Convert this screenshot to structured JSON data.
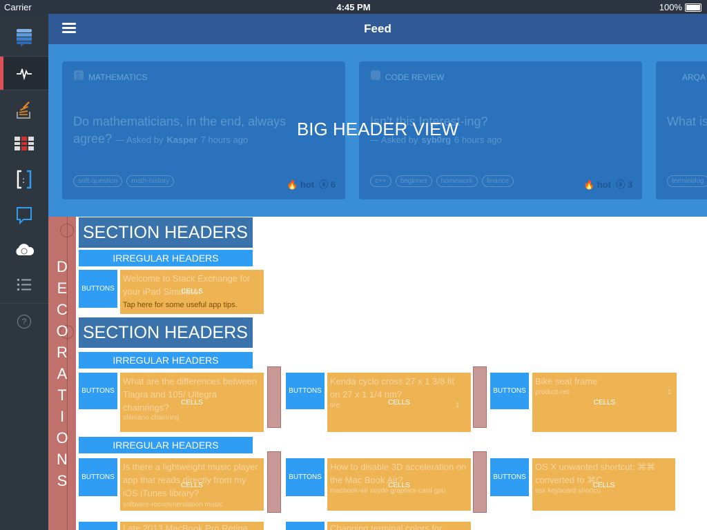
{
  "status_bar": {
    "carrier": "Carrier",
    "time": "4:45 PM",
    "battery": "100%"
  },
  "nav": {
    "title": "Feed"
  },
  "sidebar": {
    "items": [
      {
        "icon": "stack-exchange-logo-icon"
      },
      {
        "icon": "activity-pulse-icon",
        "active": true
      },
      {
        "icon": "stack-overflow-icon"
      },
      {
        "icon": "server-fault-icon"
      },
      {
        "icon": "code-review-icon"
      },
      {
        "icon": "chat-bubble-icon"
      },
      {
        "icon": "cloud-icon"
      },
      {
        "icon": "list-icon"
      },
      {
        "icon": "help-icon",
        "label": "?"
      }
    ]
  },
  "big_header": {
    "label": "BIG HEADER VIEW",
    "cards": [
      {
        "site": "MATHEMATICS",
        "question": "Do mathematicians, in the end, always agree?",
        "asked_prefix": "— Asked by",
        "user": "Kasper",
        "when": "7 hours ago",
        "tags": [
          "soft-question",
          "math-history"
        ],
        "badge": "hot",
        "count": "6"
      },
      {
        "site": "CODE REVIEW",
        "question": "Isn't this Interest-ing?",
        "asked_prefix": "— Asked by",
        "user": "syb0rg",
        "when": "6 hours ago",
        "tags": [
          "c++",
          "beginner",
          "homework",
          "finance"
        ],
        "badge": "hot",
        "count": "3"
      },
      {
        "site": "ARQA",
        "question": "What is",
        "tags": [
          "terminolog"
        ]
      }
    ]
  },
  "decorations": {
    "letters": [
      "D",
      "E",
      "C",
      "O",
      "R",
      "A",
      "T",
      "I",
      "O",
      "N",
      "S"
    ]
  },
  "labels": {
    "section": "SECTION HEADERS",
    "irregular": "IRREGULAR HEADERS",
    "buttons": "BUTTONS",
    "cells": "CELLS"
  },
  "feed": {
    "welcome": {
      "title": "Welcome to Stack Exchange for your iPad Simulator",
      "tip": "Tap here for some useful app tips."
    },
    "row1": [
      {
        "title": "What are the differences between Tiagra and 105/ Ultegra chainrings?",
        "tags": "shimano   chainring"
      },
      {
        "title": "Kenda cyclo cross 27 x 1 3/8 fit on 27 x 1 1/4 rim?",
        "tags": "tire",
        "count": "1"
      },
      {
        "title": "Bike seat frame",
        "tags": "product-rec",
        "count": "1"
      }
    ],
    "row2": [
      {
        "title": "Is there a lightweight music player app that reads directly from my iOS iTunes library?",
        "tags": "software-recommendation   music"
      },
      {
        "title": "How to disable 3D acceleration on the Mac Book Air?",
        "tags": "macbook-air   xcode   graphics-card   gpu"
      },
      {
        "title": "OS X unwanted shortcut: ⌘⌘ converted to ⌘C",
        "tags": "osx   keyboard   shortcu"
      }
    ],
    "row3": [
      {
        "title": "Late 2013 MacBook Pro Retina"
      },
      {
        "title": "Changing terminal colors for"
      }
    ]
  }
}
